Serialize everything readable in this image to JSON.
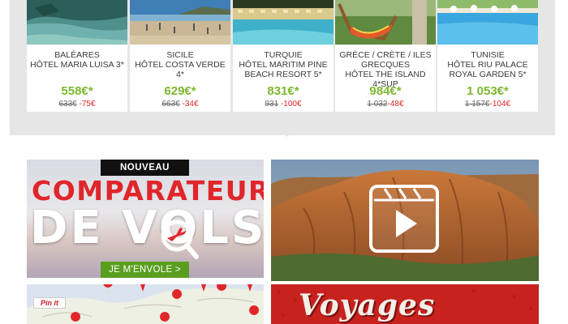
{
  "deals": [
    {
      "destination": "BALÉARES",
      "hotel": "HÔTEL MARIA LUISA 3*",
      "price": "558€*",
      "old_price": "633€",
      "discount": " -75€",
      "image_icon": "beach-photo"
    },
    {
      "destination": "SICILE",
      "hotel": "HÔTEL COSTA VERDE 4*",
      "price": "629€*",
      "old_price": "663€",
      "discount": " -34€",
      "image_icon": "beach-photo"
    },
    {
      "destination": "TURQUIE",
      "hotel": "HÔTEL MARITIM PINE BEACH RESORT 5*",
      "price": "831€*",
      "old_price": "931",
      "discount": " -100€",
      "image_icon": "pool-photo"
    },
    {
      "destination": "GRÈCE / CRÈTE / ILES GRECQUES",
      "hotel": "HÔTEL THE ISLAND 4*sup",
      "price": "984€*",
      "old_price": "1 032",
      "discount": "-48€",
      "image_icon": "hammock-photo"
    },
    {
      "destination": "TUNISIE",
      "hotel": "HÔTEL RIU PALACE ROYAL GARDEN 5*",
      "price": "1 053€*",
      "old_price": "1 157€",
      "discount": "-104€",
      "image_icon": "pool-photo"
    }
  ],
  "comparateur": {
    "badge": "NOUVEAU",
    "title_line1": "COMPARATEUR",
    "title_line2": "DE VOLS",
    "cta": "JE M'ENVOLE >"
  },
  "video": {
    "icon": "video-play-icon"
  },
  "map": {
    "pin_label": "Pin it"
  },
  "voyages": {
    "title": "Voyages"
  },
  "colors": {
    "price_green": "#7cb82f",
    "discount_red": "#e0262b",
    "brand_red": "#c8221f",
    "cta_green": "#5a9e1f"
  }
}
